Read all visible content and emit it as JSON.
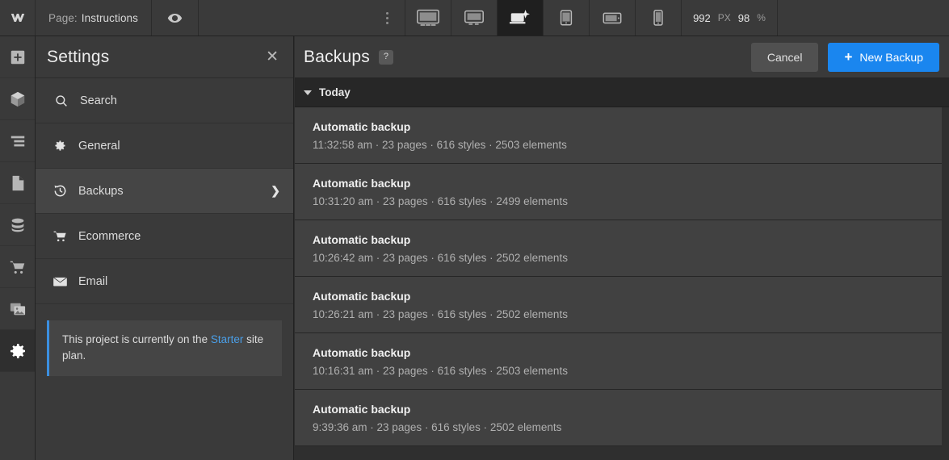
{
  "topbar": {
    "logo_icon": "webflow-logo-icon",
    "page_label": "Page:",
    "page_name": "Instructions",
    "eye_icon": "eye-preview-icon",
    "options_icon": "more-options-icon",
    "devices": [
      {
        "name": "device-desktop-large",
        "icon": "monitor-icon",
        "active": false
      },
      {
        "name": "device-desktop",
        "icon": "monitor-icon",
        "active": false
      },
      {
        "name": "device-base",
        "icon": "laptop-star-icon",
        "active": true
      },
      {
        "name": "device-tablet",
        "icon": "tablet-icon",
        "active": false
      },
      {
        "name": "device-mobile-landscape",
        "icon": "mobile-landscape-icon",
        "active": false
      },
      {
        "name": "device-mobile-portrait",
        "icon": "mobile-portrait-icon",
        "active": false
      }
    ],
    "canvas_width": "992",
    "canvas_width_unit": "PX",
    "zoom_value": "98",
    "zoom_unit": "%"
  },
  "rail": {
    "items": [
      {
        "name": "add-elements",
        "icon": "plus-square-icon",
        "active": false
      },
      {
        "name": "components",
        "icon": "cube-icon",
        "active": false
      },
      {
        "name": "style-manager",
        "icon": "style-list-icon",
        "active": false
      },
      {
        "name": "pages",
        "icon": "page-icon",
        "active": false
      },
      {
        "name": "cms-collections",
        "icon": "database-icon",
        "active": false
      },
      {
        "name": "ecommerce",
        "icon": "shopping-cart-icon",
        "active": false
      },
      {
        "name": "assets",
        "icon": "images-icon",
        "active": false
      },
      {
        "name": "settings",
        "icon": "gear-icon",
        "active": true
      }
    ]
  },
  "settings_panel": {
    "title": "Settings",
    "close_icon": "close-icon",
    "menu": [
      {
        "label": "Search",
        "icon": "search-icon",
        "active": false,
        "chevron": false
      },
      {
        "label": "General",
        "icon": "gear-icon",
        "active": false,
        "chevron": false
      },
      {
        "label": "Backups",
        "icon": "history-restore-icon",
        "active": true,
        "chevron": true
      },
      {
        "label": "Ecommerce",
        "icon": "shopping-cart-icon",
        "active": false,
        "chevron": false
      },
      {
        "label": "Email",
        "icon": "envelope-icon",
        "active": false,
        "chevron": false
      }
    ],
    "chevron_glyph": "❯",
    "plan_note": {
      "text_before": "This project is currently on the ",
      "link": "Starter",
      "text_after": " site plan.",
      "accent_color": "#3b8fe0"
    }
  },
  "backups": {
    "title": "Backups",
    "help_badge": "?",
    "cancel_label": "Cancel",
    "new_backup_label": "New Backup",
    "new_backup_plus": "+",
    "accent_color": "#1a86ef",
    "group_label": "Today",
    "items": [
      {
        "title": "Automatic backup",
        "meta": "11:32:58 am · 23 pages · 616 styles · 2503 elements"
      },
      {
        "title": "Automatic backup",
        "meta": "10:31:20 am · 23 pages · 616 styles · 2499 elements"
      },
      {
        "title": "Automatic backup",
        "meta": "10:26:42 am · 23 pages · 616 styles · 2502 elements"
      },
      {
        "title": "Automatic backup",
        "meta": "10:26:21 am · 23 pages · 616 styles · 2502 elements"
      },
      {
        "title": "Automatic backup",
        "meta": "10:16:31 am · 23 pages · 616 styles · 2503 elements"
      },
      {
        "title": "Automatic backup",
        "meta": "9:39:36 am · 23 pages · 616 styles · 2502 elements"
      }
    ]
  }
}
